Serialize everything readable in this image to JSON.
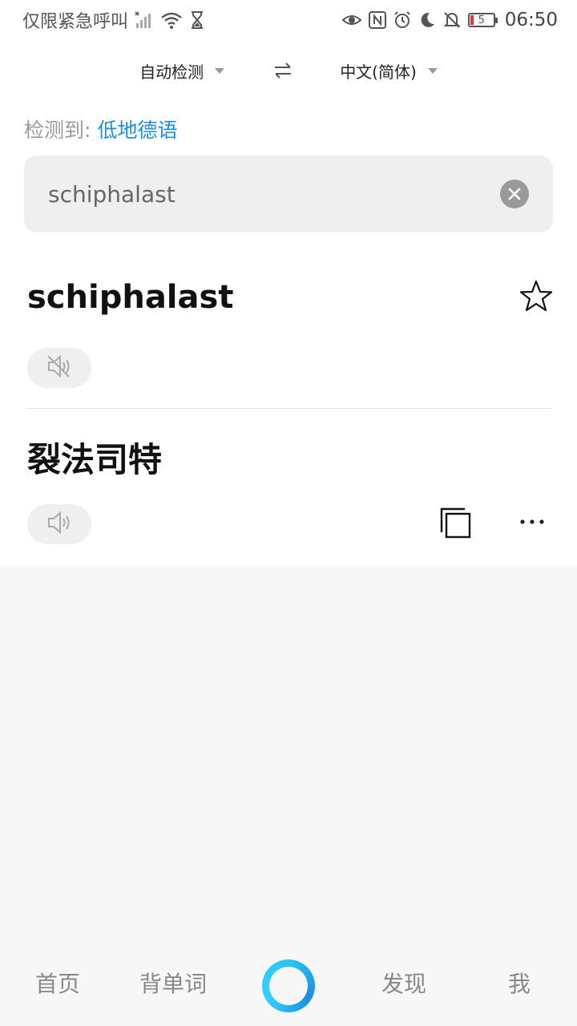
{
  "status_bar": {
    "carrier": "仅限紧急呼叫",
    "battery": "5",
    "time": "06:50"
  },
  "lang_bar": {
    "source": "自动检测",
    "target": "中文(简体)"
  },
  "detect": {
    "label": "检测到:",
    "language": "低地德语"
  },
  "search": {
    "value": "schiphalast"
  },
  "result": {
    "word": "schiphalast",
    "translation": "裂法司特"
  },
  "bottom_nav": {
    "home": "首页",
    "vocab": "背单词",
    "discover": "发现",
    "me": "我"
  },
  "colors": {
    "accent": "#1a8ee1",
    "ring": "#29c5f6"
  }
}
